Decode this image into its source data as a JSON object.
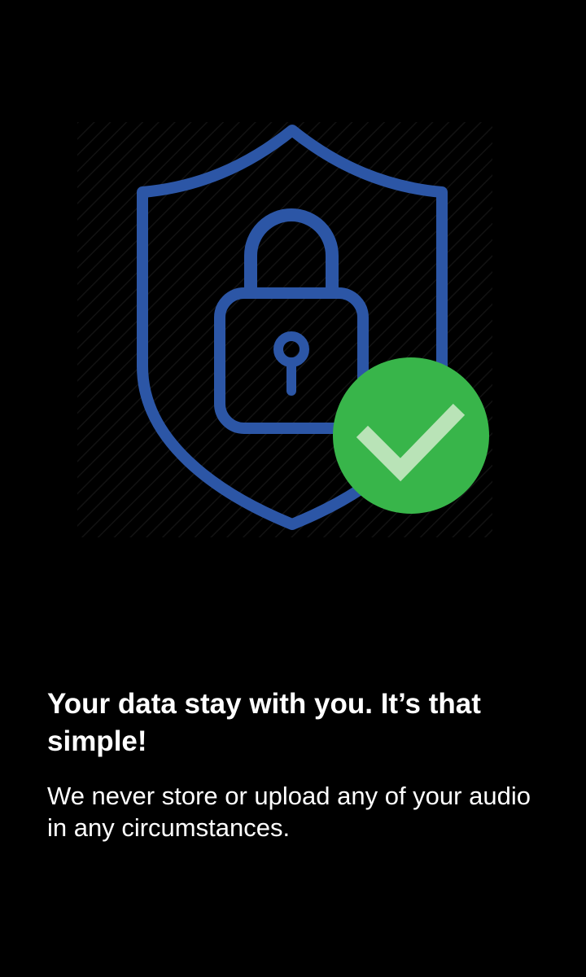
{
  "illustration": {
    "shield_icon": "shield-icon",
    "lock_icon": "lock-icon",
    "check_badge_icon": "checkmark-badge-icon",
    "colors": {
      "background": "#000000",
      "shield_stroke": "#2c56a6",
      "badge_fill": "#38b54a",
      "check_stroke": "#b9e3b7"
    }
  },
  "content": {
    "headline": "Your data stay with you. It’s that simple!",
    "body": "We never store or upload any of your audio in any circumstances."
  }
}
